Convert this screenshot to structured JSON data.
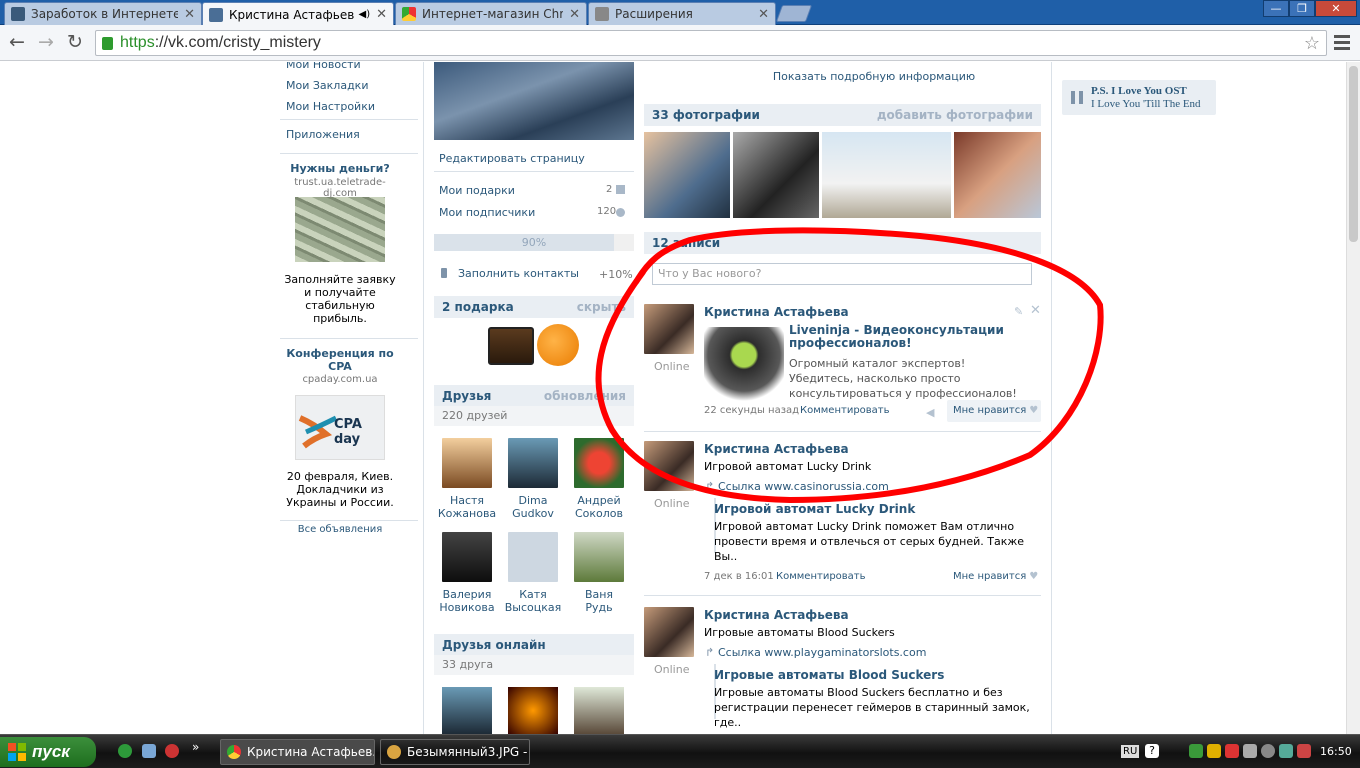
{
  "browser": {
    "tabs": [
      {
        "label": "Заработок в Интернете | Ч",
        "active": false
      },
      {
        "label": "Кристина Астафьева",
        "active": true
      },
      {
        "label": "Интернет-магазин Chrome",
        "active": false
      },
      {
        "label": "Расширения",
        "active": false
      }
    ],
    "url_scheme": "https",
    "url_rest": "://vk.com/cristy_mistery",
    "win": [
      "—",
      "❐",
      "✕"
    ]
  },
  "left_menu": {
    "items": [
      "Мои Новости",
      "Мои Закладки",
      "Мои Настройки"
    ],
    "apps": "Приложения"
  },
  "ads": [
    {
      "title": "Нужны деньги?",
      "domain": "trust.ua.teletrade-dj.com",
      "text": "Заполняйте заявку и получайте стабильную прибыль."
    },
    {
      "title": "Конференция по CPA",
      "domain": "cpaday.com.ua",
      "logo_text": "CPA day",
      "text": "20 февраля, Киев. Докладчики из Украины и России."
    }
  ],
  "all_ads": "Все объявления",
  "profile": {
    "edit": "Редактировать страницу",
    "gifts": "Мои подарки",
    "gifts_count": "2",
    "subs": "Мои подписчики",
    "subs_count": "120",
    "progress_label": "90%",
    "progress": 0.9,
    "fill_contacts": "Заполнить контакты",
    "fill_bonus": "+10%"
  },
  "gifts_block": {
    "title": "2 подарка",
    "action": "скрыть"
  },
  "friends_block": {
    "title": "Друзья",
    "action": "обновления",
    "count": "220 друзей",
    "friends": [
      [
        "Настя",
        "Кожанова"
      ],
      [
        "Dima",
        "Gudkov"
      ],
      [
        "Андрей",
        "Соколов"
      ],
      [
        "Валерия",
        "Новикова"
      ],
      [
        "Катя",
        "Высоцкая"
      ],
      [
        "Ваня",
        "Рудь"
      ]
    ]
  },
  "online_block": {
    "title": "Друзья онлайн",
    "count": "33 друга"
  },
  "main": {
    "show_more": "Показать подробную информацию",
    "photos_title": "33 фотографии",
    "photos_action": "добавить фотографии",
    "wall_title": "12 записи",
    "wall_placeholder": "Что у Вас нового?",
    "posts": [
      {
        "author": "Кристина Астафьева",
        "online": "Online",
        "link_title": "Liveninja - Видеоконсультации профессионалов!",
        "link_desc": "Огромный каталог экспертов! Убедитесь, насколько просто консультироваться у профессионалов!",
        "time": "22 секунды назад",
        "comment": "Комментировать",
        "like": "Мне нравится"
      },
      {
        "author": "Кристина Астафьева",
        "online": "Online",
        "text": "Игровой автомат Lucky Drink",
        "link": "Ссылка www.casinorussia.com",
        "link_title": "Игровой автомат Lucky Drink",
        "link_desc": "Игровой автомат Lucky Drink поможет Вам отлично провести время и отвлечься от серых будней. Также Вы..",
        "time": "7 дек в 16:01",
        "comment": "Комментировать",
        "like": "Мне нравится"
      },
      {
        "author": "Кристина Астафьева",
        "online": "Online",
        "text": "Игровые автоматы Blood Suckers",
        "link": "Ссылка www.playgaminatorslots.com",
        "link_title": "Игровые автоматы Blood Suckers",
        "link_desc": "Игровые автоматы Blood Suckers бесплатно и без регистрации перенесет геймеров в старинный замок, где.."
      }
    ]
  },
  "player": {
    "title": "P.S. I Love You OST",
    "track": "I Love You 'Till The End"
  },
  "taskbar": {
    "start": "пуск",
    "buttons": [
      "Кристина Астафьев...",
      "Безымянный3.JPG - ..."
    ],
    "lang": "RU",
    "clock": "16:50"
  },
  "colors": {
    "vk_link": "#2b587a",
    "annotation": "#ff0000"
  }
}
